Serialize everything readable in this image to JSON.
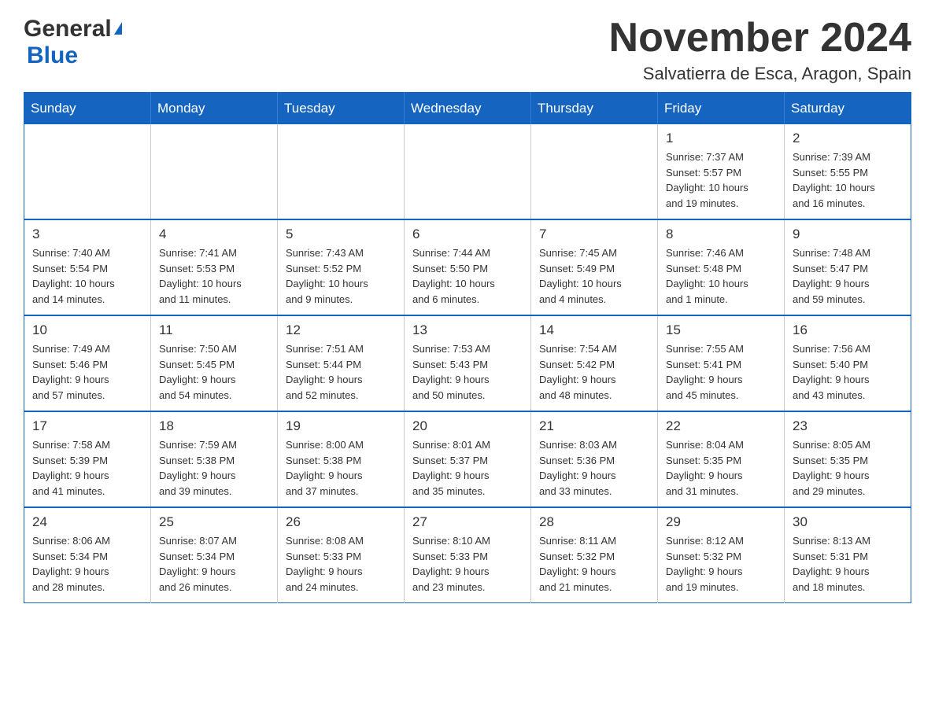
{
  "header": {
    "logo_general": "General",
    "logo_blue": "Blue",
    "month_title": "November 2024",
    "location": "Salvatierra de Esca, Aragon, Spain"
  },
  "weekdays": [
    "Sunday",
    "Monday",
    "Tuesday",
    "Wednesday",
    "Thursday",
    "Friday",
    "Saturday"
  ],
  "weeks": [
    [
      {
        "day": "",
        "info": ""
      },
      {
        "day": "",
        "info": ""
      },
      {
        "day": "",
        "info": ""
      },
      {
        "day": "",
        "info": ""
      },
      {
        "day": "",
        "info": ""
      },
      {
        "day": "1",
        "info": "Sunrise: 7:37 AM\nSunset: 5:57 PM\nDaylight: 10 hours\nand 19 minutes."
      },
      {
        "day": "2",
        "info": "Sunrise: 7:39 AM\nSunset: 5:55 PM\nDaylight: 10 hours\nand 16 minutes."
      }
    ],
    [
      {
        "day": "3",
        "info": "Sunrise: 7:40 AM\nSunset: 5:54 PM\nDaylight: 10 hours\nand 14 minutes."
      },
      {
        "day": "4",
        "info": "Sunrise: 7:41 AM\nSunset: 5:53 PM\nDaylight: 10 hours\nand 11 minutes."
      },
      {
        "day": "5",
        "info": "Sunrise: 7:43 AM\nSunset: 5:52 PM\nDaylight: 10 hours\nand 9 minutes."
      },
      {
        "day": "6",
        "info": "Sunrise: 7:44 AM\nSunset: 5:50 PM\nDaylight: 10 hours\nand 6 minutes."
      },
      {
        "day": "7",
        "info": "Sunrise: 7:45 AM\nSunset: 5:49 PM\nDaylight: 10 hours\nand 4 minutes."
      },
      {
        "day": "8",
        "info": "Sunrise: 7:46 AM\nSunset: 5:48 PM\nDaylight: 10 hours\nand 1 minute."
      },
      {
        "day": "9",
        "info": "Sunrise: 7:48 AM\nSunset: 5:47 PM\nDaylight: 9 hours\nand 59 minutes."
      }
    ],
    [
      {
        "day": "10",
        "info": "Sunrise: 7:49 AM\nSunset: 5:46 PM\nDaylight: 9 hours\nand 57 minutes."
      },
      {
        "day": "11",
        "info": "Sunrise: 7:50 AM\nSunset: 5:45 PM\nDaylight: 9 hours\nand 54 minutes."
      },
      {
        "day": "12",
        "info": "Sunrise: 7:51 AM\nSunset: 5:44 PM\nDaylight: 9 hours\nand 52 minutes."
      },
      {
        "day": "13",
        "info": "Sunrise: 7:53 AM\nSunset: 5:43 PM\nDaylight: 9 hours\nand 50 minutes."
      },
      {
        "day": "14",
        "info": "Sunrise: 7:54 AM\nSunset: 5:42 PM\nDaylight: 9 hours\nand 48 minutes."
      },
      {
        "day": "15",
        "info": "Sunrise: 7:55 AM\nSunset: 5:41 PM\nDaylight: 9 hours\nand 45 minutes."
      },
      {
        "day": "16",
        "info": "Sunrise: 7:56 AM\nSunset: 5:40 PM\nDaylight: 9 hours\nand 43 minutes."
      }
    ],
    [
      {
        "day": "17",
        "info": "Sunrise: 7:58 AM\nSunset: 5:39 PM\nDaylight: 9 hours\nand 41 minutes."
      },
      {
        "day": "18",
        "info": "Sunrise: 7:59 AM\nSunset: 5:38 PM\nDaylight: 9 hours\nand 39 minutes."
      },
      {
        "day": "19",
        "info": "Sunrise: 8:00 AM\nSunset: 5:38 PM\nDaylight: 9 hours\nand 37 minutes."
      },
      {
        "day": "20",
        "info": "Sunrise: 8:01 AM\nSunset: 5:37 PM\nDaylight: 9 hours\nand 35 minutes."
      },
      {
        "day": "21",
        "info": "Sunrise: 8:03 AM\nSunset: 5:36 PM\nDaylight: 9 hours\nand 33 minutes."
      },
      {
        "day": "22",
        "info": "Sunrise: 8:04 AM\nSunset: 5:35 PM\nDaylight: 9 hours\nand 31 minutes."
      },
      {
        "day": "23",
        "info": "Sunrise: 8:05 AM\nSunset: 5:35 PM\nDaylight: 9 hours\nand 29 minutes."
      }
    ],
    [
      {
        "day": "24",
        "info": "Sunrise: 8:06 AM\nSunset: 5:34 PM\nDaylight: 9 hours\nand 28 minutes."
      },
      {
        "day": "25",
        "info": "Sunrise: 8:07 AM\nSunset: 5:34 PM\nDaylight: 9 hours\nand 26 minutes."
      },
      {
        "day": "26",
        "info": "Sunrise: 8:08 AM\nSunset: 5:33 PM\nDaylight: 9 hours\nand 24 minutes."
      },
      {
        "day": "27",
        "info": "Sunrise: 8:10 AM\nSunset: 5:33 PM\nDaylight: 9 hours\nand 23 minutes."
      },
      {
        "day": "28",
        "info": "Sunrise: 8:11 AM\nSunset: 5:32 PM\nDaylight: 9 hours\nand 21 minutes."
      },
      {
        "day": "29",
        "info": "Sunrise: 8:12 AM\nSunset: 5:32 PM\nDaylight: 9 hours\nand 19 minutes."
      },
      {
        "day": "30",
        "info": "Sunrise: 8:13 AM\nSunset: 5:31 PM\nDaylight: 9 hours\nand 18 minutes."
      }
    ]
  ]
}
